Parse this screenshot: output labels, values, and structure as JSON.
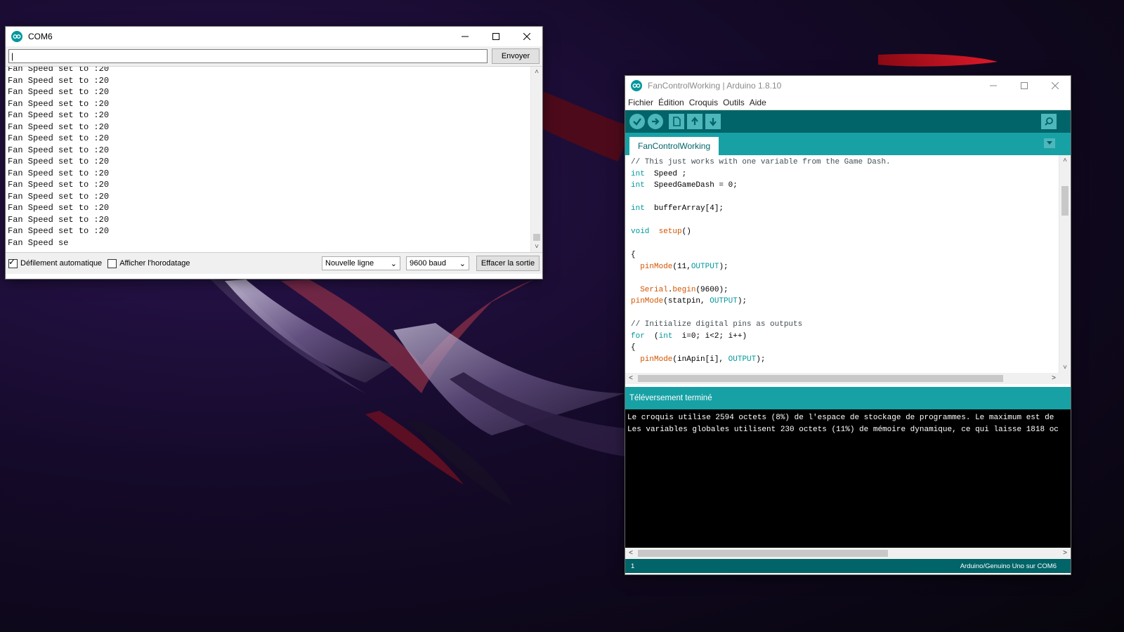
{
  "serial_monitor": {
    "title": "COM6",
    "input_value": "|",
    "send_label": "Envoyer",
    "lines": [
      "Fan Speed set to :20",
      "Fan Speed set to :20",
      "Fan Speed set to :20",
      "Fan Speed set to :20",
      "Fan Speed set to :20",
      "Fan Speed set to :20",
      "Fan Speed set to :20",
      "Fan Speed set to :20",
      "Fan Speed set to :20",
      "Fan Speed set to :20",
      "Fan Speed set to :20",
      "Fan Speed set to :20",
      "Fan Speed set to :20",
      "Fan Speed set to :20",
      "Fan Speed set to :20",
      "Fan Speed se"
    ],
    "autoscroll_label": "Défilement automatique",
    "autoscroll_checked": true,
    "timestamp_label": "Afficher l'horodatage",
    "timestamp_checked": false,
    "line_ending": "Nouvelle ligne",
    "baud": "9600 baud",
    "clear_label": "Effacer la sortie"
  },
  "ide": {
    "title": "FanControlWorking | Arduino 1.8.10",
    "menu": [
      "Fichier",
      "Édition",
      "Croquis",
      "Outils",
      "Aide"
    ],
    "tab_label": "FanControlWorking",
    "code_lines": [
      [
        [
          "c-com",
          "// This just works with one variable from the Game Dash."
        ]
      ],
      [
        [
          "c-kw",
          "int"
        ],
        [
          "",
          "  Speed ;"
        ]
      ],
      [
        [
          "c-kw",
          "int"
        ],
        [
          "",
          "  SpeedGameDash = 0;"
        ]
      ],
      [
        [
          "",
          ""
        ]
      ],
      [
        [
          "c-kw",
          "int"
        ],
        [
          "",
          "  bufferArray[4];"
        ]
      ],
      [
        [
          "",
          ""
        ]
      ],
      [
        [
          "c-kw",
          "void"
        ],
        [
          "",
          "  "
        ],
        [
          "c-fn",
          "setup"
        ],
        [
          "",
          "()"
        ]
      ],
      [
        [
          "",
          ""
        ]
      ],
      [
        [
          "",
          "{"
        ]
      ],
      [
        [
          "",
          "  "
        ],
        [
          "c-fn",
          "pinMode"
        ],
        [
          "",
          "(11,"
        ],
        [
          "c-kw",
          "OUTPUT"
        ],
        [
          "",
          ");"
        ]
      ],
      [
        [
          "",
          ""
        ]
      ],
      [
        [
          "",
          "  "
        ],
        [
          "c-fn",
          "Serial"
        ],
        [
          "",
          "."
        ],
        [
          "c-fn",
          "begin"
        ],
        [
          "",
          "(9600);"
        ]
      ],
      [
        [
          "c-fn",
          "pinMode"
        ],
        [
          "",
          "(statpin, "
        ],
        [
          "c-kw",
          "OUTPUT"
        ],
        [
          "",
          ");"
        ]
      ],
      [
        [
          "",
          ""
        ]
      ],
      [
        [
          "c-com",
          "// Initialize digital pins as outputs"
        ]
      ],
      [
        [
          "c-kw",
          "for"
        ],
        [
          "",
          "  ("
        ],
        [
          "c-kw",
          "int"
        ],
        [
          "",
          "  i=0; i<2; i++)"
        ]
      ],
      [
        [
          "",
          "{"
        ]
      ],
      [
        [
          "",
          "  "
        ],
        [
          "c-fn",
          "pinMode"
        ],
        [
          "",
          "(inApin[i], "
        ],
        [
          "c-kw",
          "OUTPUT"
        ],
        [
          "",
          ");"
        ]
      ]
    ],
    "status_message": "Téléversement terminé",
    "console_lines": [
      "Le croquis utilise 2594 octets (8%) de l'espace de stockage de programmes. Le maximum est de",
      "Les variables globales utilisent 230 octets (11%) de mémoire dynamique, ce qui laisse 1818 oc"
    ],
    "line_number": "1",
    "board": "Arduino/Genuino Uno sur COM6"
  },
  "colors": {
    "arduino_dark": "#006468",
    "arduino_teal": "#17a1a5",
    "keyword": "#00979c",
    "function": "#d35400"
  }
}
